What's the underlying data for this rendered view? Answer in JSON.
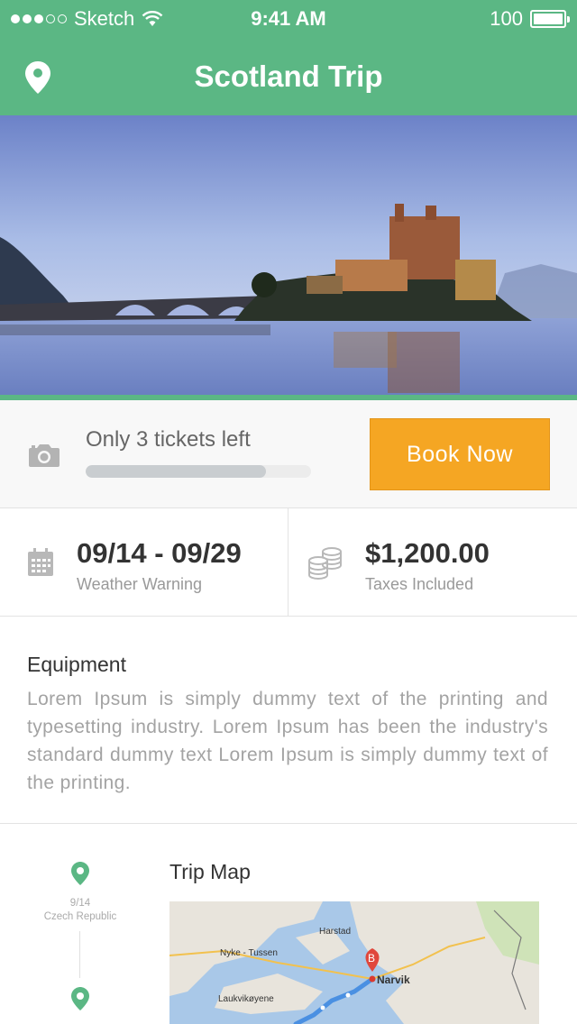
{
  "status_bar": {
    "carrier": "Sketch",
    "time": "9:41 AM",
    "battery": "100",
    "signal_icon": "signal-dots-icon",
    "wifi_icon": "wifi-icon",
    "battery_icon": "battery-icon"
  },
  "header": {
    "title": "Scotland Trip",
    "icon": "location-pin-icon",
    "bg_color": "#5bb784"
  },
  "hero": {
    "description_icon": "castle-photo"
  },
  "tickets": {
    "icon": "camera-icon",
    "text": "Only 3 tickets left",
    "progress_percent": 80,
    "button_label": "Book Now",
    "button_color": "#f5a623"
  },
  "dates": {
    "icon": "calendar-icon",
    "range": "09/14 - 09/29",
    "note": "Weather Warning"
  },
  "price": {
    "icon": "coins-icon",
    "amount": "$1,200.00",
    "note": "Taxes Included"
  },
  "equipment": {
    "title": "Equipment",
    "text": "Lorem Ipsum is simply dummy text of the printing and typesetting industry. Lorem Ipsum has been the industry's standard dummy text Lorem Ipsum is simply dummy text of the printing."
  },
  "timeline": {
    "stops": [
      {
        "date": "9/14",
        "place": "Czech Republic",
        "icon": "location-pin-icon"
      },
      {
        "icon": "location-pin-icon"
      }
    ]
  },
  "trip_map": {
    "title": "Trip Map",
    "labels": [
      "Harstad",
      "Nyke - Tussen",
      "Narvik",
      "Laukvikøyene"
    ],
    "marker": "B"
  }
}
